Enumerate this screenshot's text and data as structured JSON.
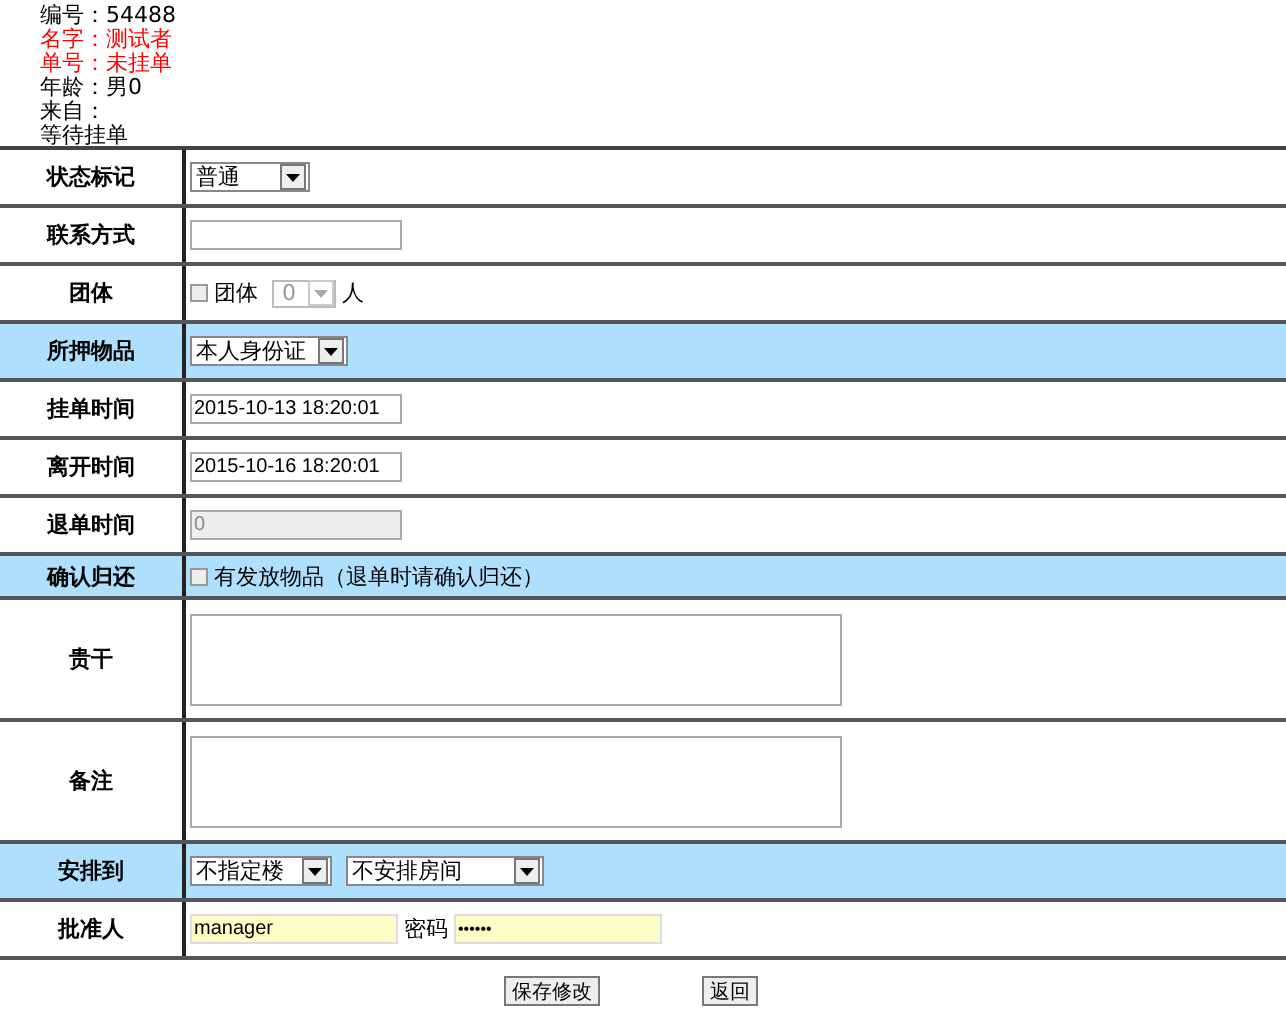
{
  "header_lines": [
    {
      "text": "编号：54488",
      "highlighted": false
    },
    {
      "text": "名字：测试者",
      "highlighted": true
    },
    {
      "text": "单号：未挂单",
      "highlighted": true
    },
    {
      "text": "年龄：男0",
      "highlighted": false
    },
    {
      "text": "来自：",
      "highlighted": false
    },
    {
      "text": "等待挂单",
      "highlighted": false
    }
  ],
  "rows": [
    {
      "label": "状态标记",
      "highlighted": false,
      "kind": "select",
      "value": "普通"
    },
    {
      "label": "联系方式",
      "highlighted": false,
      "kind": "text"
    },
    {
      "label": "团体",
      "highlighted": false,
      "kind": "group",
      "checkbox_label": "团体",
      "checked": false,
      "count": "0",
      "unit": "人"
    },
    {
      "label": "所押物品",
      "highlighted": true,
      "kind": "select",
      "value": "本人身份证"
    },
    {
      "label": "挂单时间",
      "highlighted": false,
      "kind": "text",
      "value": "2015-10-13 18:20:01"
    },
    {
      "label": "离开时间",
      "highlighted": false,
      "kind": "text",
      "value": "2015-10-16 18:20:01"
    },
    {
      "label": "退单时间",
      "highlighted": false,
      "kind": "readonly",
      "value": "0"
    },
    {
      "label": "确认归还",
      "highlighted": true,
      "kind": "checkbox",
      "checkbox_label": "有发放物品（退单时请确认归还）",
      "checked": false
    },
    {
      "label": "贵干",
      "highlighted": false,
      "kind": "textarea"
    },
    {
      "label": "备注",
      "highlighted": false,
      "kind": "textarea"
    },
    {
      "label": "安排到",
      "highlighted": true,
      "kind": "selects",
      "values": [
        "不指定楼",
        "不安排房间"
      ]
    },
    {
      "label": "批准人",
      "highlighted": false,
      "kind": "approver",
      "value": "manager",
      "password_label": "密码",
      "password_dots": "••••••"
    }
  ],
  "buttons": [
    "保存修改",
    "返回"
  ]
}
